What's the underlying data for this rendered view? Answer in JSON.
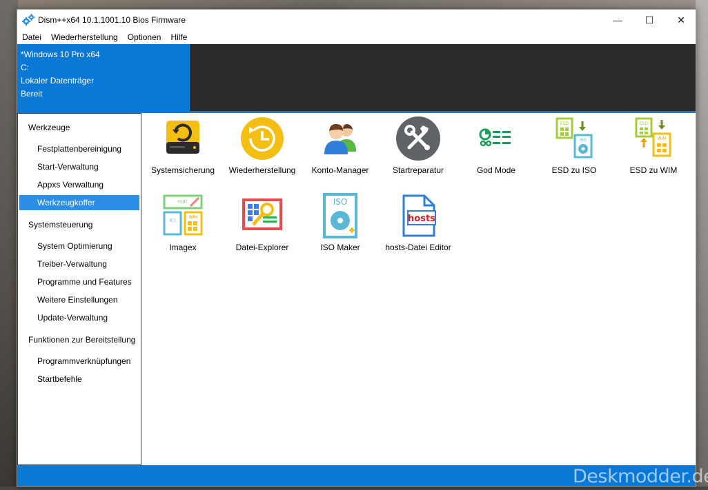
{
  "window": {
    "title": "Dism++x64 10.1.1001.10 Bios Firmware",
    "controls": {
      "minimize": "—",
      "maximize": "☐",
      "close": "✕"
    }
  },
  "menu": [
    "Datei",
    "Wiederherstellung",
    "Optionen",
    "Hilfe"
  ],
  "session": {
    "os": "*Windows 10 Pro x64",
    "drive": "C:",
    "volume": "Lokaler Datenträger",
    "status": "Bereit"
  },
  "sidebar": {
    "groups": [
      {
        "label": "Werkzeuge",
        "items": [
          "Festplattenbereinigung",
          "Start-Verwaltung",
          "Appxs Verwaltung",
          "Werkzeugkoffer"
        ]
      },
      {
        "label": "Systemsteuerung",
        "items": [
          "System Optimierung",
          "Treiber-Verwaltung",
          "Programme und Features",
          "Weitere Einstellungen",
          "Update-Verwaltung"
        ]
      },
      {
        "label": "Funktionen zur Bereitstellung",
        "items": [
          "Programmverknüpfungen",
          "Startbefehle"
        ]
      }
    ],
    "selected": "Werkzeugkoffer"
  },
  "tools": [
    {
      "label": "Systemsicherung",
      "icon": "backup-drive-icon"
    },
    {
      "label": "Wiederherstellung",
      "icon": "restore-clock-icon"
    },
    {
      "label": "Konto-Manager",
      "icon": "users-icon"
    },
    {
      "label": "Startreparatur",
      "icon": "repair-tools-icon"
    },
    {
      "label": "God Mode",
      "icon": "god-mode-icon"
    },
    {
      "label": "ESD zu ISO",
      "icon": "esd-to-iso-icon"
    },
    {
      "label": "ESD zu WIM",
      "icon": "esd-to-wim-icon"
    },
    {
      "label": "Imagex",
      "icon": "imagex-icon",
      "edit_text": "EDIT",
      "x_text": "X:\\",
      "wim_text": "WIM"
    },
    {
      "label": "Datei-Explorer",
      "icon": "file-explorer-icon"
    },
    {
      "label": "ISO Maker",
      "icon": "iso-maker-icon",
      "iso_text": "ISO"
    },
    {
      "label": "hosts-Datei Editor",
      "icon": "hosts-editor-icon",
      "hosts_text": "hosts"
    }
  ],
  "esd_iso_texts": {
    "esd": "ESD",
    "iso": "ISO",
    "wim": "WIM"
  },
  "watermark": "Deskmodder.de",
  "colors": {
    "accent": "#0a78d7",
    "dark_panel": "#2b2b2b",
    "selection": "#2a8ee6"
  }
}
